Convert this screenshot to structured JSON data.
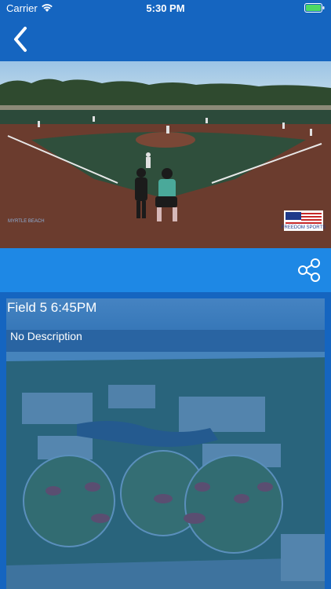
{
  "status_bar": {
    "carrier": "Carrier",
    "time": "5:30 PM"
  },
  "nav": {
    "back_icon": "chevron-left-icon"
  },
  "video": {
    "description": "softball game video frame",
    "watermark_left": "MYRTLE BEACH",
    "watermark_right": "FREEDOM SPORTS"
  },
  "actions": {
    "share_icon": "share-icon"
  },
  "event": {
    "title": "Field 5 6:45PM",
    "description": "No Description"
  },
  "colors": {
    "header_blue": "#1565c0",
    "action_blue": "#1e88e5",
    "overlay_blue": "#1f6fb8"
  }
}
